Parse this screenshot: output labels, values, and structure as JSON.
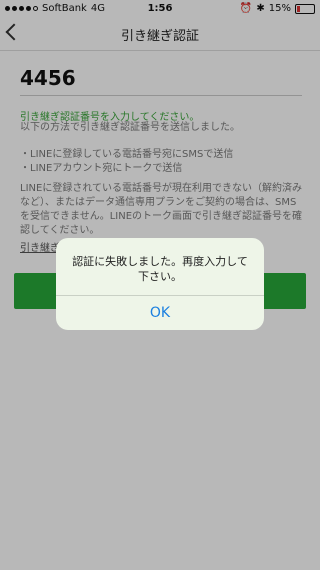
{
  "status_bar": {
    "carrier": "SoftBank",
    "network": "4G",
    "time": "1:56",
    "battery_percent": "15%"
  },
  "nav": {
    "title": "引き継ぎ認証"
  },
  "code_input": {
    "value": "4456"
  },
  "instructions": {
    "heading": "引き継ぎ認証番号を入力してください。",
    "subtext": "以下の方法で引き継ぎ認証番号を送信しました。",
    "method1": "・LINEに登録している電話番号宛にSMSで送信",
    "method2": "・LINEアカウント宛にトークで送信",
    "paragraph": "LINEに登録されている電話番号が現在利用できない（解約済みなど）、またはデータ通信専用プランをご契約の場合は、SMSを受信できません。LINEのトーク画面で引き継ぎ認証番号を確認してください。",
    "link": "引き継ぎ"
  },
  "dialog": {
    "message": "認証に失敗しました。再度入力して下さい。",
    "ok_label": "OK"
  }
}
